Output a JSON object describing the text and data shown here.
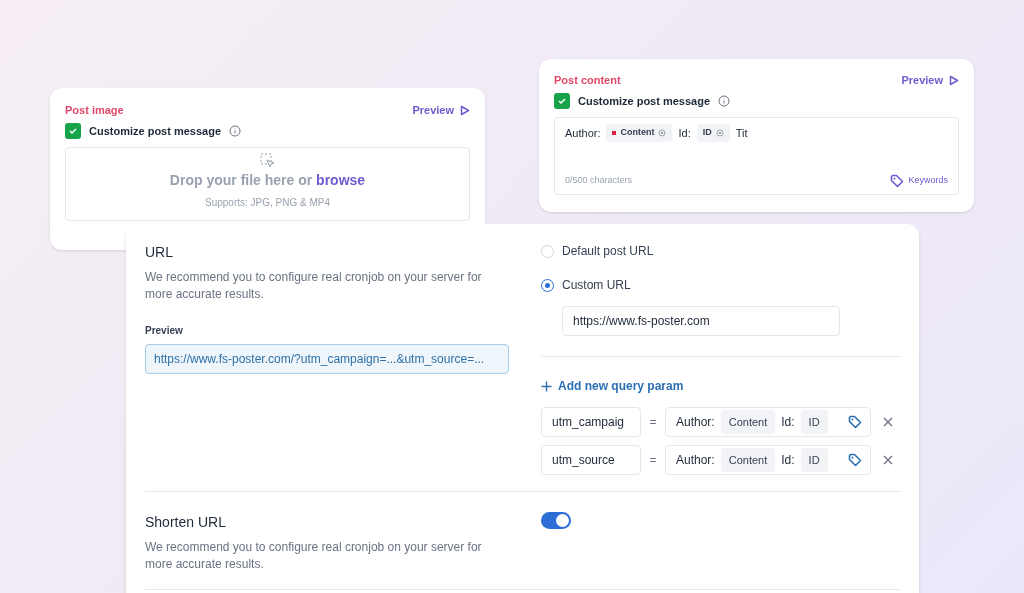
{
  "post_image": {
    "title": "Post image",
    "preview": "Preview",
    "customize": {
      "label": "Customize post message",
      "checked": true
    },
    "dropzone": {
      "text": "Drop your file here or ",
      "link": "browse",
      "hint": "Supports: JPG, PNG & MP4"
    }
  },
  "post_content": {
    "title": "Post content",
    "preview": "Preview",
    "customize": {
      "label": "Customize post message",
      "checked": true
    },
    "editor": {
      "parts": [
        {
          "kind": "text",
          "text": "Author:"
        },
        {
          "kind": "tag",
          "text": "Content",
          "color": "#e11d48"
        },
        {
          "kind": "text",
          "text": "Id:"
        },
        {
          "kind": "tag",
          "text": "ID"
        },
        {
          "kind": "text",
          "text": "Tit"
        }
      ],
      "counter": "0/500 characters",
      "keywords": "Keywords"
    }
  },
  "url_section": {
    "title": "URL",
    "description": "We recommend you to configure real cronjob on your server for more accurate results.",
    "preview_label": "Preview",
    "preview_value": "https://www.fs-poster.com/?utm_campaign=...&utm_source=...",
    "options": [
      {
        "label": "Default post URL",
        "selected": false
      },
      {
        "label": "Custom URL",
        "selected": true
      }
    ],
    "custom_url": "https://www.fs-poster.com",
    "add_param": "Add new query param",
    "params": [
      {
        "key": "utm_campaig",
        "equals": "=",
        "parts": [
          {
            "kind": "text",
            "text": "Author:"
          },
          {
            "kind": "tag",
            "text": "Content"
          },
          {
            "kind": "text",
            "text": "Id:"
          },
          {
            "kind": "tag",
            "text": "ID"
          }
        ]
      },
      {
        "key": "utm_source",
        "equals": "=",
        "parts": [
          {
            "kind": "text",
            "text": "Author:"
          },
          {
            "kind": "tag",
            "text": "Content"
          },
          {
            "kind": "text",
            "text": "Id:"
          },
          {
            "kind": "tag",
            "text": "ID"
          }
        ]
      }
    ]
  },
  "shorten_section": {
    "title": "Shorten URL",
    "description": "We recommend you to configure real cronjob on your server for more accurate results.",
    "on": true
  }
}
